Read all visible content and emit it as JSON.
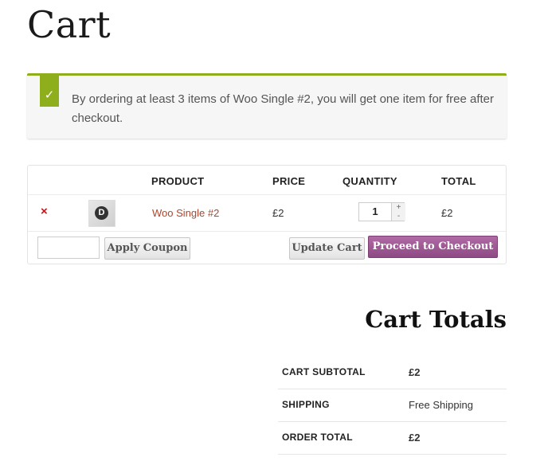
{
  "page": {
    "title": "Cart"
  },
  "notice": {
    "icon": "checkmark-icon",
    "glyph": "✓",
    "text": "By ordering at least 3 items of Woo Single #2, you will get one item for free after checkout.",
    "accent_color": "#8fae1b"
  },
  "cart_table": {
    "headers": {
      "product": "PRODUCT",
      "price": "PRICE",
      "quantity": "QUANTITY",
      "total": "TOTAL"
    },
    "items": [
      {
        "remove_glyph": "×",
        "thumbnail_icon": "product-thumbnail-icon",
        "name": "Woo Single #2",
        "price": "£2",
        "quantity": "1",
        "total": "£2"
      }
    ],
    "qty_plus": "+",
    "qty_minus": "-"
  },
  "actions": {
    "coupon_placeholder": "",
    "apply_coupon": "Apply Coupon",
    "update_cart": "Update Cart",
    "checkout": "Proceed to Checkout →",
    "checkout_color": "#9b5893"
  },
  "totals": {
    "title": "Cart Totals",
    "rows": [
      {
        "label": "CART SUBTOTAL",
        "value": "£2"
      },
      {
        "label": "SHIPPING",
        "value": "Free Shipping"
      },
      {
        "label": "ORDER TOTAL",
        "value": "£2"
      }
    ]
  }
}
